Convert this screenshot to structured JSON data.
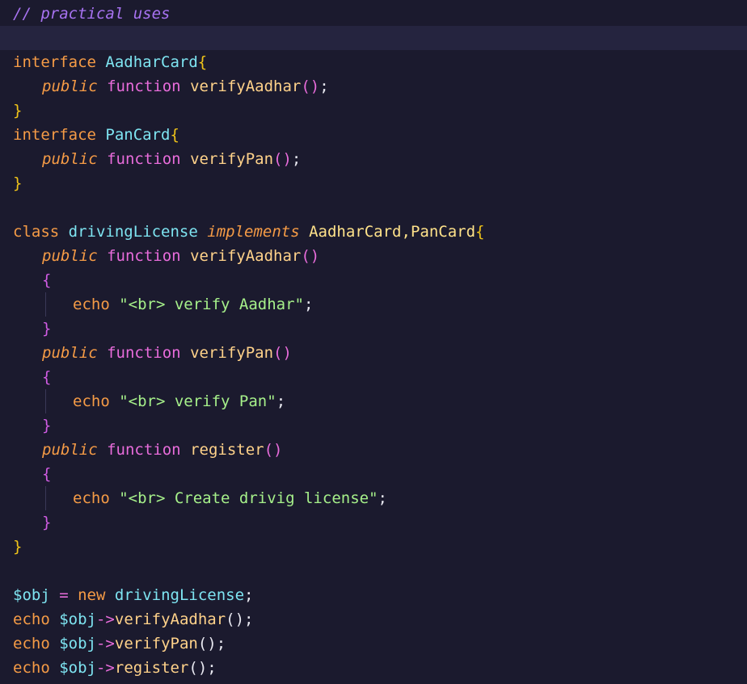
{
  "editor": {
    "comment": "// practical uses",
    "iface1": {
      "keyword": "interface",
      "name": "AadharCard",
      "method": "verifyAadhar"
    },
    "iface2": {
      "keyword": "interface",
      "name": "PanCard",
      "method": "verifyPan"
    },
    "public": "public",
    "function": "function",
    "open_brace": "{",
    "close_brace": "}",
    "parens": "()",
    "semicolon": ";",
    "cls": {
      "keyword": "class",
      "name": "drivingLicense",
      "implements": "implements",
      "interfaces": "AadharCard,PanCard",
      "m1": "verifyAadhar",
      "s1": "\"<br> verify Aadhar\"",
      "m2": "verifyPan",
      "s2": "\"<br> verify Pan\"",
      "m3": "register",
      "s3": "\"<br> Create drivig license\""
    },
    "echo": "echo",
    "obj_var": "$obj",
    "assign": " = ",
    "new": "new",
    "arrow": "->",
    "call_suffix": "();"
  }
}
